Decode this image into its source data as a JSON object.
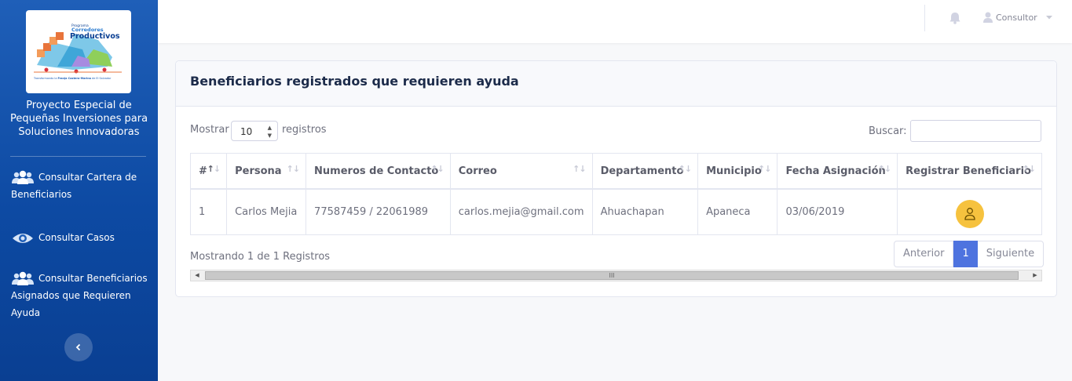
{
  "sidebar": {
    "logo": {
      "program_label": "Programa",
      "brand_line1": "Corredores",
      "brand_line2": "Productivos",
      "tagline_prefix": "Transformando la ",
      "tagline_bold": "Franja Costero-Marina",
      "tagline_suffix": " de El Salvador"
    },
    "brand_text": "Proyecto Especial de Pequeñas Inversiones para Soluciones Innovadoras",
    "items": [
      {
        "icon": "users-icon",
        "label": "Consultar Cartera de Beneficiarios"
      },
      {
        "icon": "eye-icon",
        "label": "Consultar Casos"
      },
      {
        "icon": "users-icon",
        "label": "Consultar Beneficiarios Asignados que Requieren Ayuda"
      }
    ]
  },
  "topbar": {
    "user_name": "Consultor"
  },
  "card": {
    "title": "Beneficiarios registrados que requieren ayuda",
    "length_prefix": "Mostrar",
    "length_value": "10",
    "length_suffix": "registros",
    "search_label": "Buscar:",
    "search_value": "",
    "columns": [
      "#",
      "Persona",
      "Numeros de Contacto",
      "Correo",
      "Departamento",
      "Municipio",
      "Fecha Asignación",
      "Registrar Beneficiario"
    ],
    "rows": [
      {
        "num": "1",
        "persona": "Carlos Mejia",
        "contacto": "77587459 / 22061989",
        "correo": "carlos.mejia@gmail.com",
        "departamento": "Ahuachapan",
        "municipio": "Apaneca",
        "fecha": "03/06/2019"
      }
    ],
    "info": "Mostrando 1 de 1 Registros",
    "pagination": {
      "previous": "Anterior",
      "current": "1",
      "next": "Siguiente"
    },
    "scroll_grip": "III"
  },
  "colors": {
    "sidebar": "#0d4aa3",
    "accent": "#4e73df",
    "action_button": "#f6c23e",
    "title": "#1c2b4a"
  }
}
